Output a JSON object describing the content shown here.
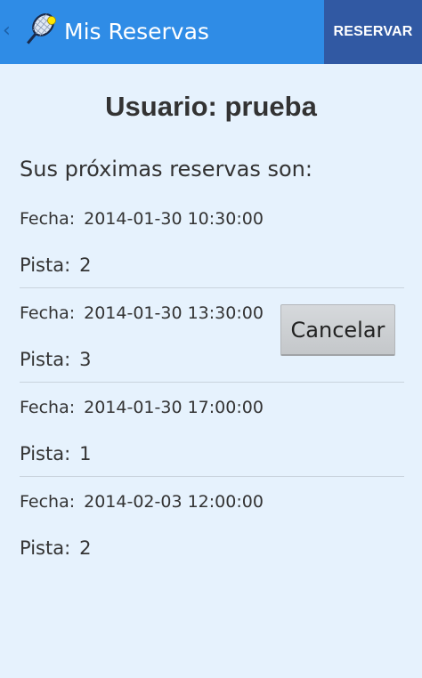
{
  "actionbar": {
    "title": "Mis Reservas",
    "reservar_label": "RESERVAR",
    "up_caret": "‹",
    "icon": "tennis-racket-icon",
    "bg_color": "#2f8ce6",
    "button_color": "#3159a3"
  },
  "main": {
    "user_title": "Usuario: prueba",
    "subtitle": "Sus próximas reservas son:",
    "fecha_label": "Fecha:",
    "pista_label": "Pista:",
    "reservations": [
      {
        "fecha": "2014-01-30 10:30:00",
        "pista": "2"
      },
      {
        "fecha": "2014-01-30 13:30:00",
        "pista": "3"
      },
      {
        "fecha": "2014-01-30 17:00:00",
        "pista": "1"
      },
      {
        "fecha": "2014-02-03 12:00:00",
        "pista": "2"
      }
    ],
    "cancel_label": "Cancelar",
    "bg_color": "#e6f2fd"
  }
}
